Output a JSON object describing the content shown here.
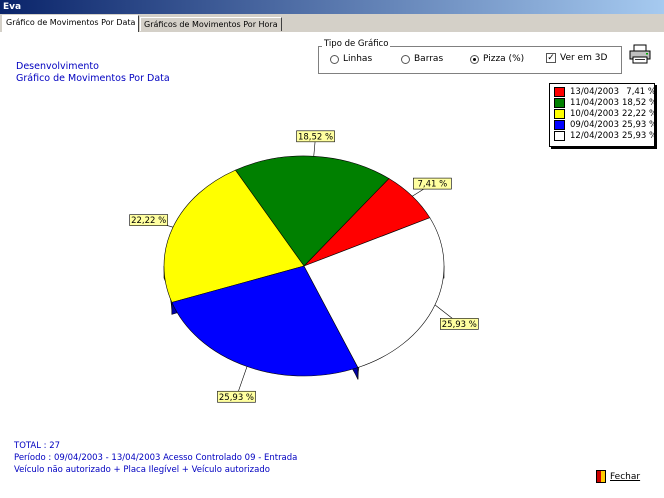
{
  "window": {
    "title": "Eva"
  },
  "tabs": [
    {
      "label": "Gráfico de Movimentos Por Data",
      "active": true
    },
    {
      "label": "Gráficos de Movimentos Por Hora",
      "active": false
    }
  ],
  "header": {
    "line1": "Desenvolvimento",
    "line2": "Gráfico de Movimentos Por Data"
  },
  "chart_type_group": {
    "label": "Tipo de Gráfico",
    "options": [
      {
        "label": "Linhas",
        "selected": false
      },
      {
        "label": "Barras",
        "selected": false
      },
      {
        "label": "Pizza (%)",
        "selected": true
      }
    ],
    "view3d": {
      "label": "Ver em 3D",
      "checked": true
    }
  },
  "chart_data": {
    "type": "pie",
    "three_d": true,
    "slices": [
      {
        "label": "13/04/2003",
        "value": 7.41,
        "value_label": "7,41 %",
        "color": "#ff0000"
      },
      {
        "label": "11/04/2003",
        "value": 18.52,
        "value_label": "18,52 %",
        "color": "#008000"
      },
      {
        "label": "10/04/2003",
        "value": 22.22,
        "value_label": "22,22 %",
        "color": "#ffff00"
      },
      {
        "label": "09/04/2003",
        "value": 25.93,
        "value_label": "25,93 %",
        "color": "#0000ff"
      },
      {
        "label": "12/04/2003",
        "value": 25.93,
        "value_label": "25,93 %",
        "color": "#ffffff"
      }
    ],
    "legend_placement": "top-right"
  },
  "legend_rows": [
    {
      "date": "13/04/2003",
      "value": "7,41 %"
    },
    {
      "date": "11/04/2003",
      "value": "18,52 %"
    },
    {
      "date": "10/04/2003",
      "value": "22,22 %"
    },
    {
      "date": "09/04/2003",
      "value": "25,93 %"
    },
    {
      "date": "12/04/2003",
      "value": "25,93 %"
    }
  ],
  "footer": {
    "total": "TOTAL : 27",
    "period": "Período : 09/04/2003 - 13/04/2003     Acesso Controlado   09 - Entrada",
    "filters": "Veículo não autorizado + Placa Ilegível + Veículo autorizado"
  },
  "buttons": {
    "print": "printer-icon",
    "close_label": "Fechar"
  }
}
